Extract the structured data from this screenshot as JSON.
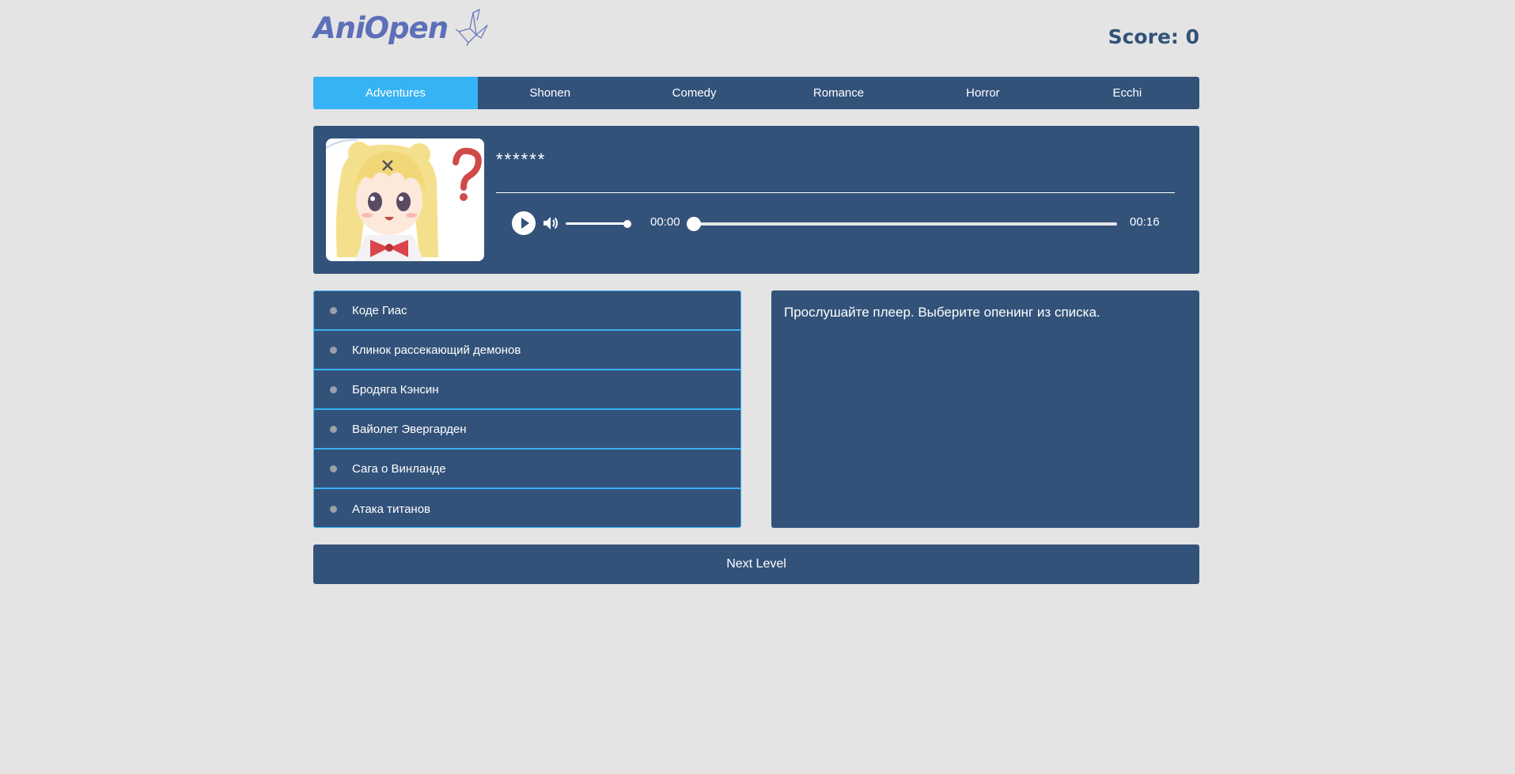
{
  "header": {
    "logo_text": "AniOpen",
    "score_label": "Score: 0"
  },
  "tabs": [
    {
      "label": "Adventures",
      "active": true
    },
    {
      "label": "Shonen",
      "active": false
    },
    {
      "label": "Comedy",
      "active": false
    },
    {
      "label": "Romance",
      "active": false
    },
    {
      "label": "Horror",
      "active": false
    },
    {
      "label": "Ecchi",
      "active": false
    }
  ],
  "player": {
    "title": "******",
    "current_time": "00:00",
    "total_time": "00:16",
    "volume_fraction": 1.0,
    "progress_fraction": 0.0,
    "icons": [
      "play-icon",
      "volume-icon"
    ]
  },
  "answers": [
    {
      "label": "Коде Гиас"
    },
    {
      "label": "Клинок рассекающий демонов"
    },
    {
      "label": "Бродяга Кэнсин"
    },
    {
      "label": "Вайолет Эвергарден"
    },
    {
      "label": "Сага о Винланде"
    },
    {
      "label": "Атака титанов"
    }
  ],
  "info": {
    "text": "Прослушайте плеер. Выберите опенинг из списка."
  },
  "next_button": {
    "label": "Next Level"
  },
  "colors": {
    "page_bg": "#e4e4e4",
    "panel": "#33527a",
    "accent": "#36b3f4",
    "logo": "#5d6fb8"
  }
}
